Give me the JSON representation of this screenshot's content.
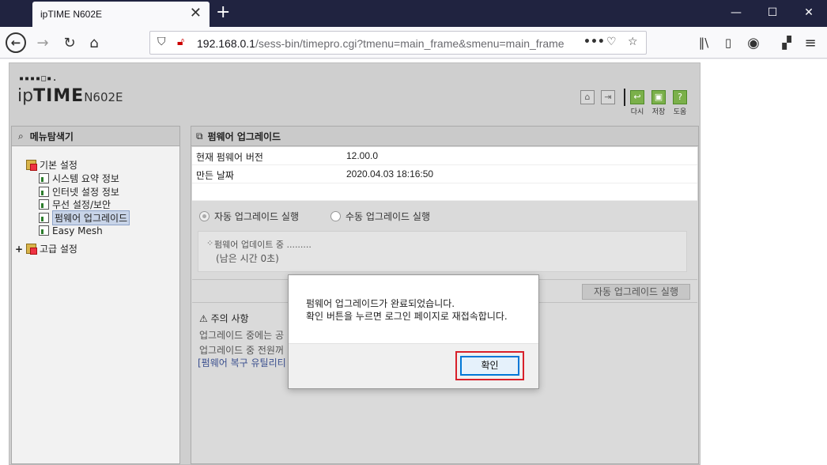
{
  "browser": {
    "tab_title": "ipTIME N602E",
    "tab_close": "✕",
    "new_tab": "+",
    "url_host": "192.168.0.1",
    "url_path": "/sess-bin/timepro.cgi?tmenu=main_frame&smenu=main_frame",
    "window_controls": [
      "—",
      "☐",
      "✕"
    ]
  },
  "router": {
    "logo_dots": "▪▪▪▪□▪.",
    "logo_prefix": "ip",
    "logo_brand": "TIME",
    "logo_model": "N602E",
    "toolbar": {
      "retry_label": "다시",
      "save_label": "저장",
      "help_label": "도움"
    }
  },
  "sidebar": {
    "title": "메뉴탐색기",
    "groups": [
      {
        "label": "기본 설정",
        "items": [
          {
            "label": "시스템 요약 정보"
          },
          {
            "label": "인터넷 설정 정보"
          },
          {
            "label": "무선 설정/보안"
          },
          {
            "label": "펌웨어 업그레이드"
          },
          {
            "label": "Easy Mesh"
          }
        ]
      },
      {
        "label": "고급 설정",
        "expander": "+"
      }
    ]
  },
  "main": {
    "title": "펌웨어 업그레이드",
    "info": [
      {
        "key": "현재 펌웨어 버전",
        "value": "12.00.0"
      },
      {
        "key": "만든 날짜",
        "value": "2020.04.03 18:16:50"
      }
    ],
    "options": {
      "auto": "자동 업그레이드 실행",
      "manual": "수동 업그레이드 실행"
    },
    "progress": {
      "line1": "펌웨어 업데이트 중 .........",
      "line2": "(남은 시간 0초)"
    },
    "auto_button": "자동 업그레이드 실행",
    "notice": {
      "title": "주의 사항",
      "line1": "업그레이드 중에는 공",
      "line2": "업그레이드 중 전원꺼",
      "link": "[펌웨어 복구 유틸리티"
    }
  },
  "dialog": {
    "line1": "펌웨어 업그레이드가 완료되었습니다.",
    "line2": "확인 버튼을 누르면 로그인 페이지로 재접속합니다.",
    "ok_label": "확인"
  }
}
